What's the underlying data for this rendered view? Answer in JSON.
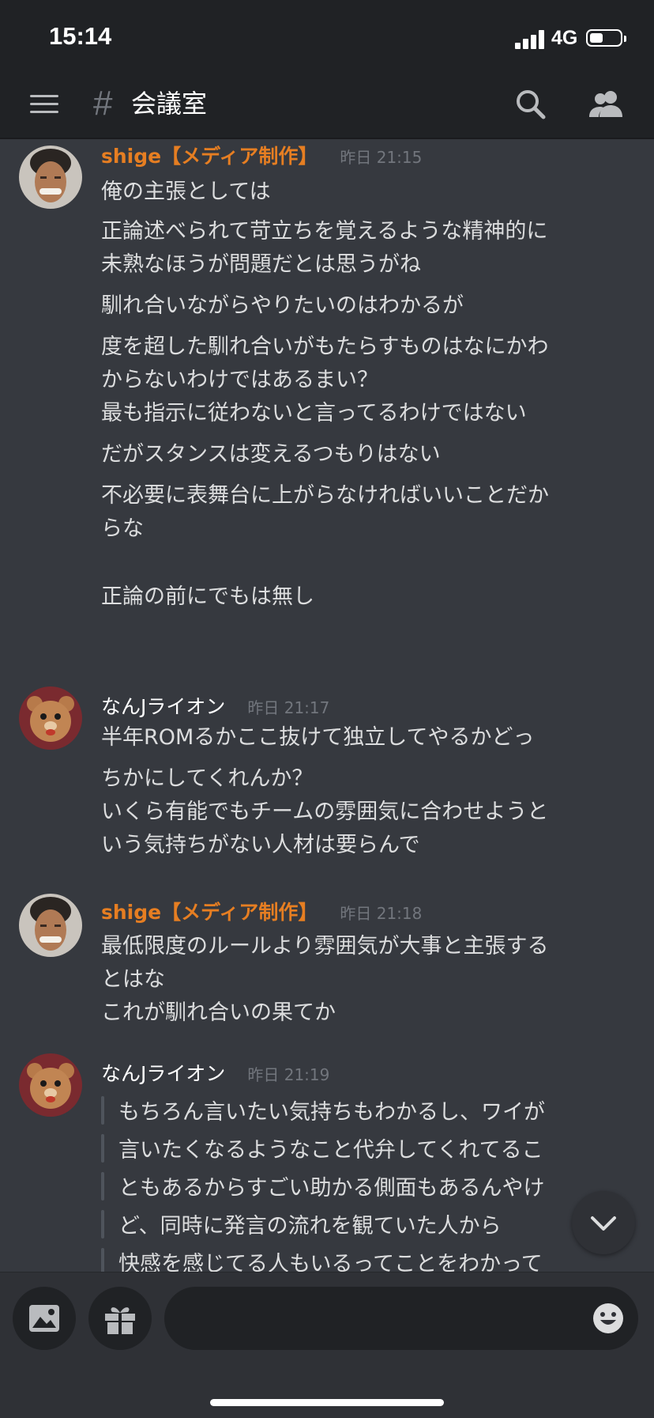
{
  "status_bar": {
    "time": "15:14",
    "network": "4G",
    "battery_level": 0.45
  },
  "header": {
    "hash_symbol": "#",
    "channel_name": "会議室",
    "icons": [
      "menu-icon",
      "search-icon",
      "members-icon"
    ]
  },
  "messages": [
    {
      "author": "shige【メディア制作】",
      "timestamp": "昨日 21:15",
      "lines": [
        "俺の主張としては",
        "正論述べられて苛立ちを覚えるような精神的に",
        "未熟なほうが問題だとは思うがね",
        "馴れ合いながらやりたいのはわかるが",
        "度を超した馴れ合いがもたらすものはなにかわ",
        "からないわけではあるまい？",
        "最も指示に従わないと言ってるわけではない",
        "だがスタンスは変えるつもりはない",
        "不必要に表舞台に上がらなければいいことだか",
        "らな",
        "正論の前にでもは無し"
      ]
    },
    {
      "author": "なんJライオン",
      "timestamp": "昨日 21:17",
      "lines": [
        "半年ROMるかここ抜けて独立してやるかどっ",
        "ちかにしてくれんか？",
        "いくら有能でもチームの雰囲気に合わせようと",
        "いう気持ちがない人材は要らんで"
      ]
    },
    {
      "author": "shige【メディア制作】",
      "timestamp": "昨日 21:18",
      "lines": [
        "最低限度のルールより雰囲気が大事と主張する",
        "とはな",
        "これが馴れ合いの果てか"
      ]
    },
    {
      "author": "なんJライオン",
      "timestamp": "昨日 21:19",
      "quote_lines": [
        "もちろん言いたい気持ちもわかるし、ワイが",
        "言いたくなるようなこと代弁してくれてるこ",
        "ともあるからすごい助かる側面もあるんやけ",
        "ど、同時に発言の流れを観ていた人から",
        "快感を感じてる人もいるってことをわかって"
      ]
    }
  ],
  "composer": {
    "placeholder": "",
    "icons": [
      "image-icon",
      "gift-icon",
      "emoji-icon",
      "chevron-down-icon"
    ]
  },
  "colors": {
    "background": "#36393f",
    "header": "#202225",
    "shige_name": "#e67e22",
    "timestamp": "#72767d",
    "text": "#dcddde"
  }
}
